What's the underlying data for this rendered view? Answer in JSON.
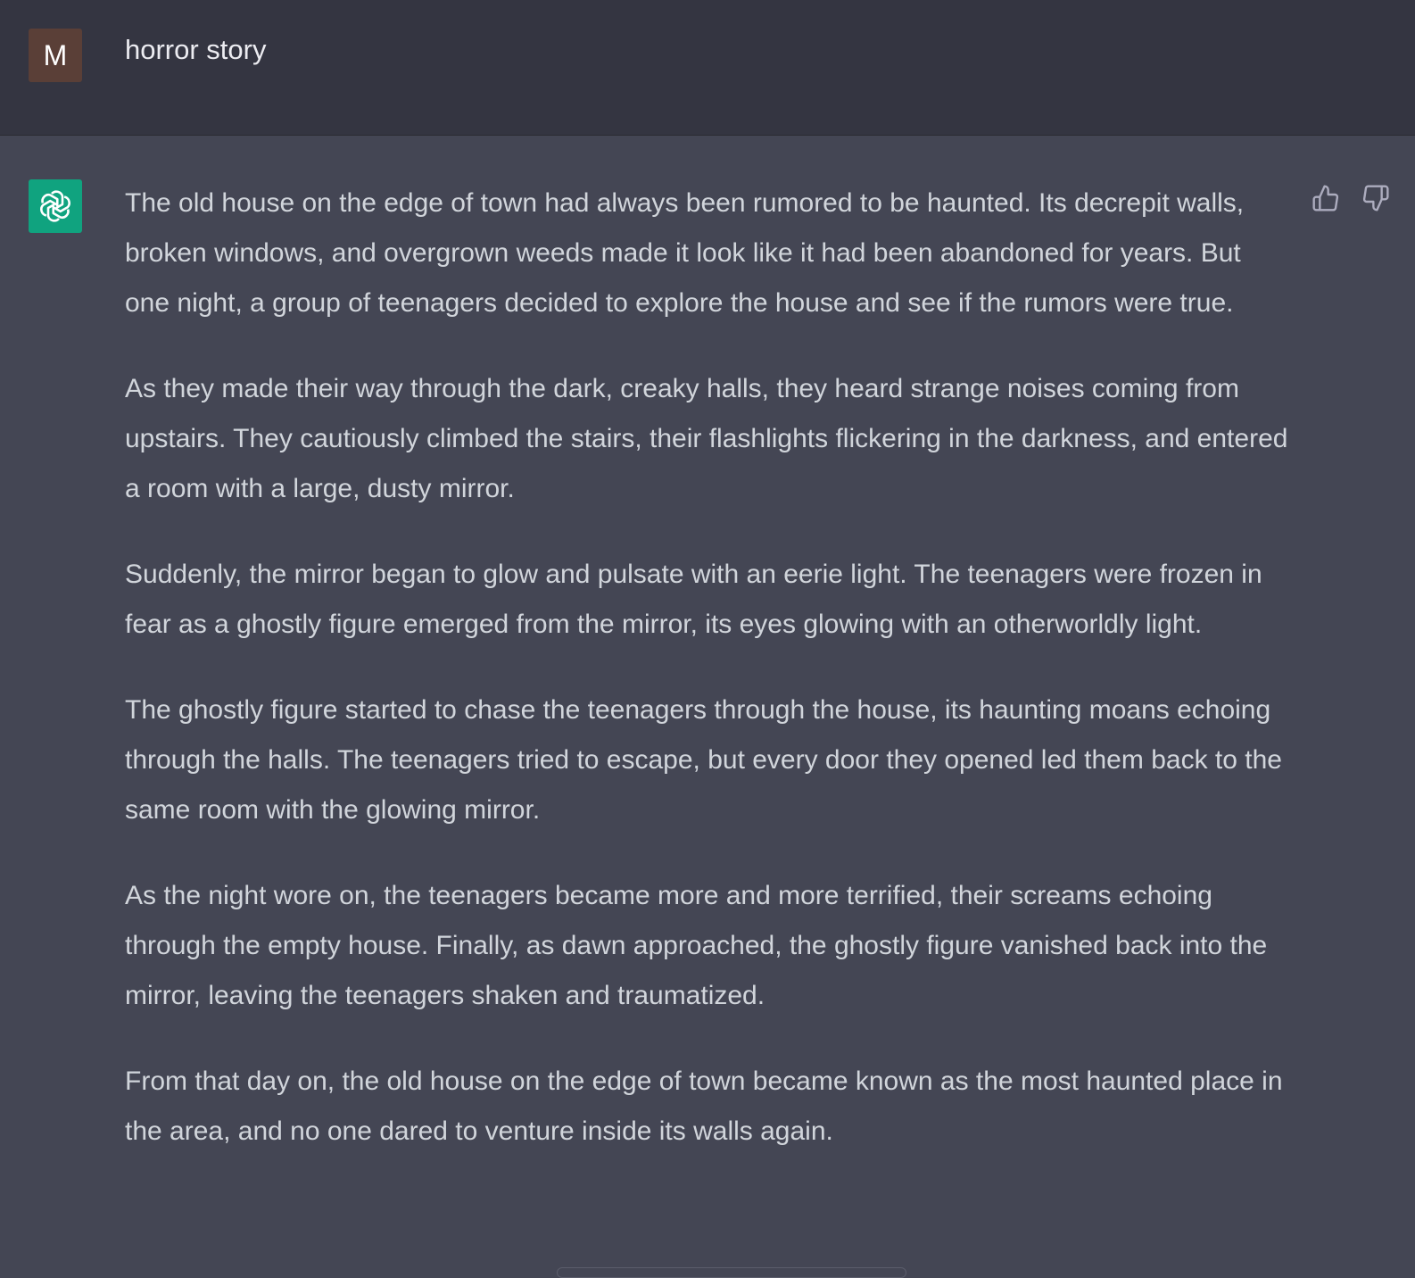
{
  "user_message": {
    "avatar_initial": "M",
    "text": "horror story"
  },
  "assistant_message": {
    "paragraphs": [
      "The old house on the edge of town had always been rumored to be haunted. Its decrepit walls, broken windows, and overgrown weeds made it look like it had been abandoned for years. But one night, a group of teenagers decided to explore the house and see if the rumors were true.",
      "As they made their way through the dark, creaky halls, they heard strange noises coming from upstairs. They cautiously climbed the stairs, their flashlights flickering in the darkness, and entered a room with a large, dusty mirror.",
      "Suddenly, the mirror began to glow and pulsate with an eerie light. The teenagers were frozen in fear as a ghostly figure emerged from the mirror, its eyes glowing with an otherworldly light.",
      "The ghostly figure started to chase the teenagers through the house, its haunting moans echoing through the halls. The teenagers tried to escape, but every door they opened led them back to the same room with the glowing mirror.",
      "As the night wore on, the teenagers became more and more terrified, their screams echoing through the empty house. Finally, as dawn approached, the ghostly figure vanished back into the mirror, leaving the teenagers shaken and traumatized.",
      "From that day on, the old house on the edge of town became known as the most haunted place in the area, and no one dared to venture inside its walls again."
    ]
  },
  "icons": {
    "bot_avatar": "openai-logo-icon",
    "feedback_up": "thumbs-up-icon",
    "feedback_down": "thumbs-down-icon"
  },
  "colors": {
    "user_row_bg": "#343541",
    "assistant_row_bg": "#444654",
    "user_avatar_bg": "#5a3f37",
    "bot_avatar_bg": "#10a37f",
    "text": "#d1d5db"
  }
}
